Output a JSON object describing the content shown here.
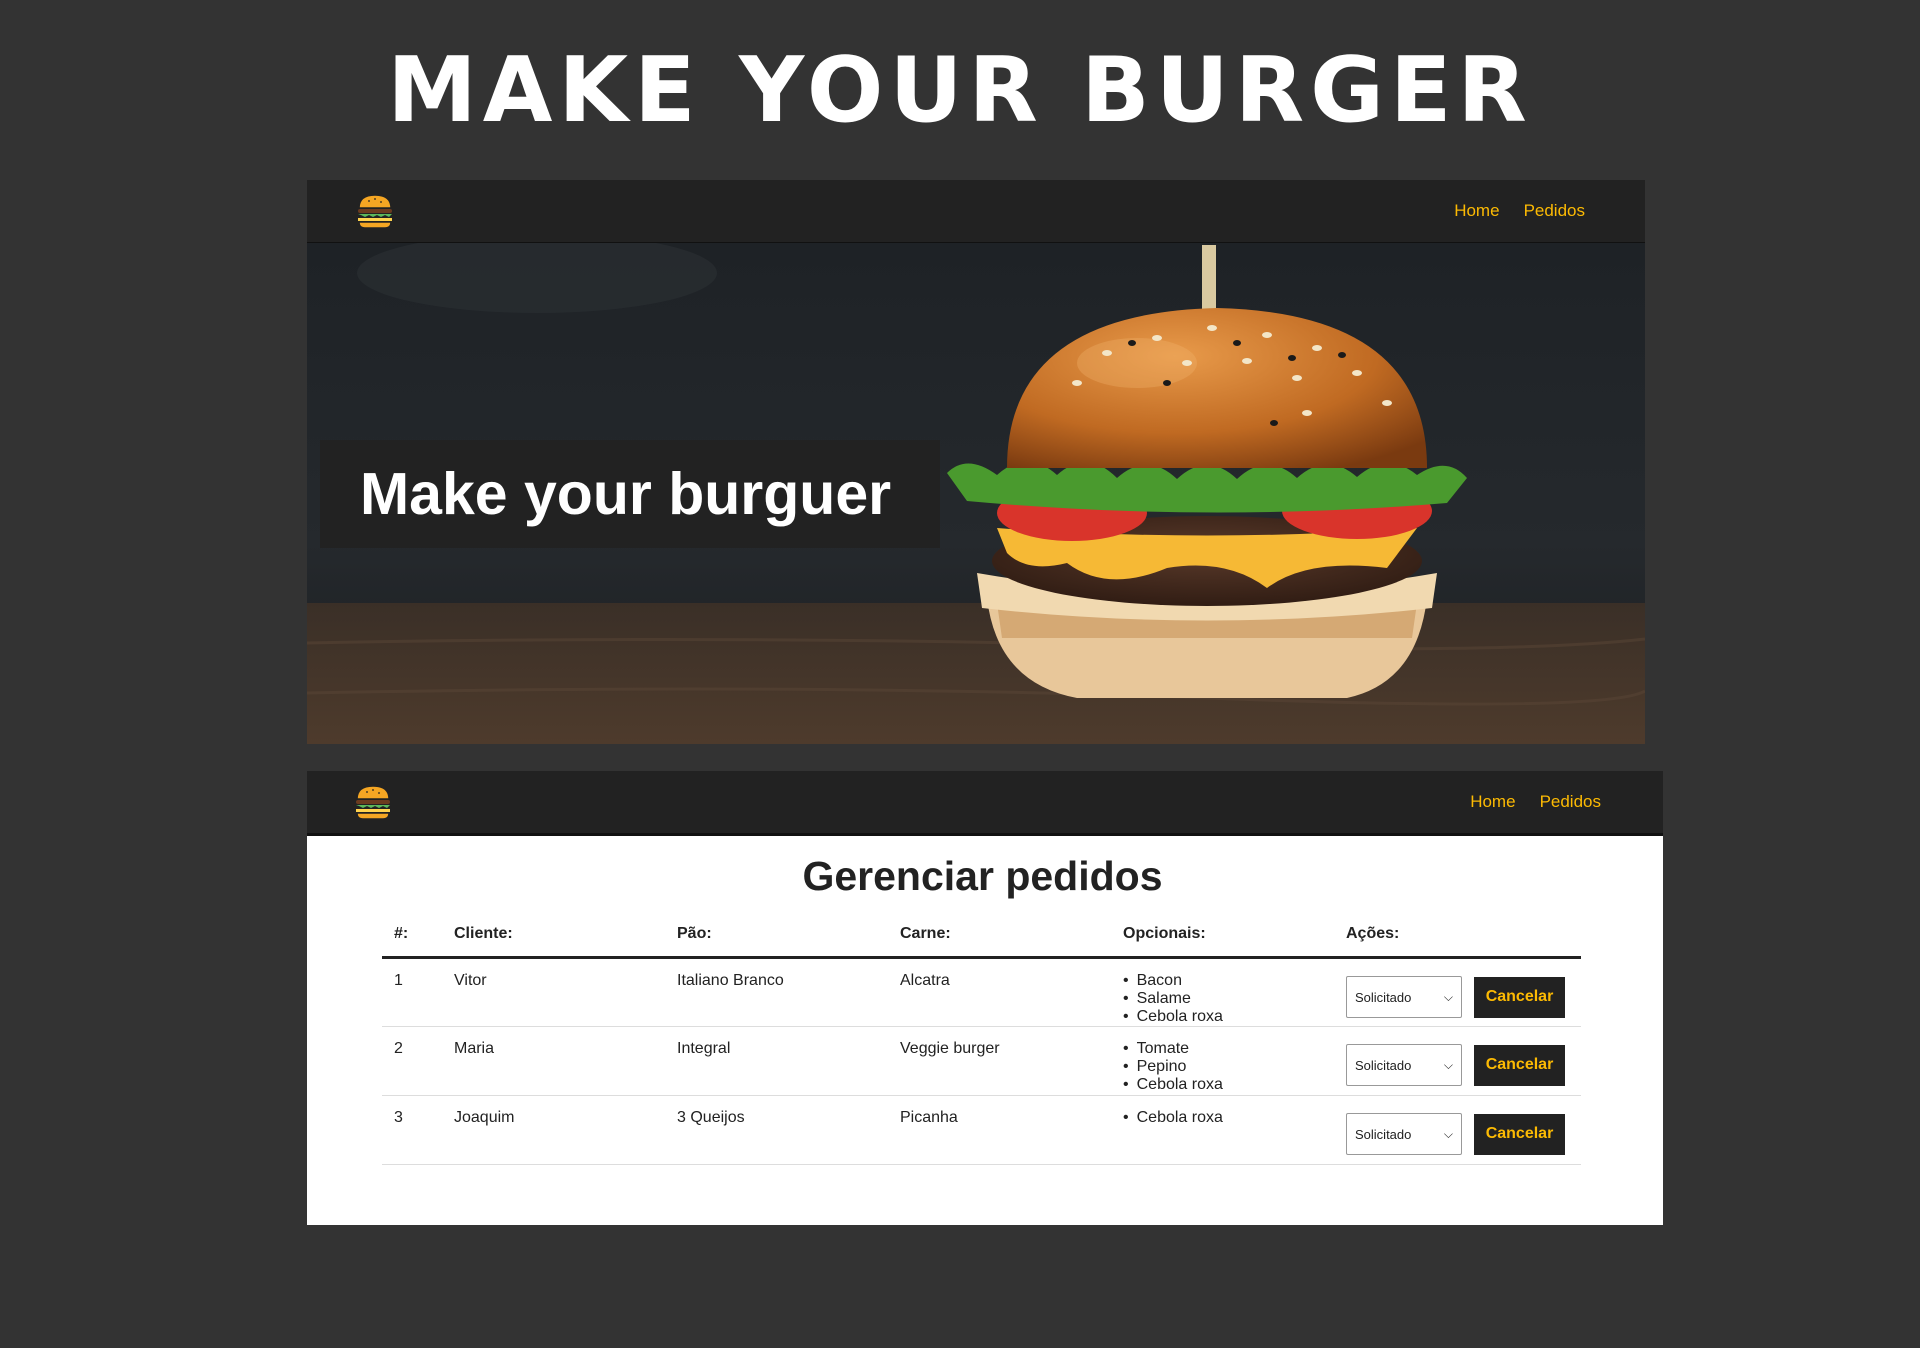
{
  "page": {
    "title": "MAKE YOUR BURGER"
  },
  "screenshot_home": {
    "nav": {
      "links": [
        {
          "label": "Home"
        },
        {
          "label": "Pedidos"
        }
      ]
    },
    "hero": {
      "heading": "Make your burguer"
    }
  },
  "screenshot_pedidos": {
    "nav": {
      "links": [
        {
          "label": "Home"
        },
        {
          "label": "Pedidos"
        }
      ]
    },
    "title": "Gerenciar pedidos",
    "table": {
      "headers": [
        "#:",
        "Cliente:",
        "Pão:",
        "Carne:",
        "Opcionais:",
        "Ações:"
      ],
      "rows": [
        {
          "id": "1",
          "cliente": "Vitor",
          "pao": "Italiano Branco",
          "carne": "Alcatra",
          "opcionais": [
            "Bacon",
            "Salame",
            "Cebola roxa"
          ],
          "status": "Solicitado",
          "cancel_label": "Cancelar"
        },
        {
          "id": "2",
          "cliente": "Maria",
          "pao": "Integral",
          "carne": "Veggie burger",
          "opcionais": [
            "Tomate",
            "Pepino",
            "Cebola roxa"
          ],
          "status": "Solicitado",
          "cancel_label": "Cancelar"
        },
        {
          "id": "3",
          "cliente": "Joaquim",
          "pao": "3 Queijos",
          "carne": "Picanha",
          "opcionais": [
            "Cebola roxa"
          ],
          "status": "Solicitado",
          "cancel_label": "Cancelar"
        }
      ]
    }
  },
  "colors": {
    "accent": "#fcba03",
    "nav_bg": "#222222",
    "page_bg": "#333333"
  },
  "icons": {
    "logo": "burger-logo-icon",
    "select_arrow": "chevron-down-icon"
  }
}
